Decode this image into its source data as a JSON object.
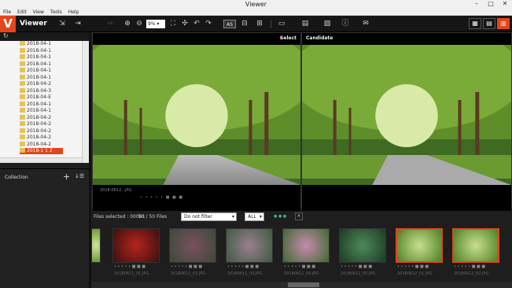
{
  "window": {
    "title": "Viewer"
  },
  "menu": [
    "File",
    "Edit",
    "View",
    "Tools",
    "Help"
  ],
  "app": {
    "logo_letter": "V",
    "name": "Viewer",
    "accent": "#e2461c"
  },
  "toolbar": {
    "zoom_value": "9%",
    "auto_size_label": "AS"
  },
  "tree": {
    "items": [
      "2018-04-1",
      "2018-04-1",
      "2018-04-1",
      "2018-04-1",
      "2018-04-1",
      "2018-04-1",
      "2018-04-2",
      "2018-04-3",
      "2018-04-E",
      "2018-04-1",
      "2018-04-1",
      "2018-04-2",
      "2018-04-2",
      "2018-04-2",
      "2018-04-2",
      "2018-04-2",
      "2018-1 1 2"
    ],
    "selected_index": 16
  },
  "collection": {
    "label": "Collection"
  },
  "viewer": {
    "left_label": "Select",
    "right_label": "Candidate",
    "left_filename": "2018-0612...JPG"
  },
  "filter": {
    "files_selected_label": "Files selected : 00001",
    "file_count": "50 / 50 Files",
    "filter_value": "Do not filter",
    "rating_value": "ALL"
  },
  "thumbnails": [
    {
      "name": "thumb-partial",
      "caption": ""
    },
    {
      "name": "thumb-red-flowers",
      "caption": "20180611_01.JPG"
    },
    {
      "name": "thumb-dandelion-blur",
      "caption": "20180611_02.JPG"
    },
    {
      "name": "thumb-dandelion-seeds",
      "caption": "20180611_03.JPG"
    },
    {
      "name": "thumb-pink-flowers",
      "caption": "20180611_04.JPG"
    },
    {
      "name": "thumb-green-bokeh",
      "caption": "20180611_05.JPG"
    },
    {
      "name": "thumb-forest-road-select",
      "caption": "20180612_01.JPG"
    },
    {
      "name": "thumb-forest-road-candidate",
      "caption": "20180612_02.JPG"
    }
  ]
}
